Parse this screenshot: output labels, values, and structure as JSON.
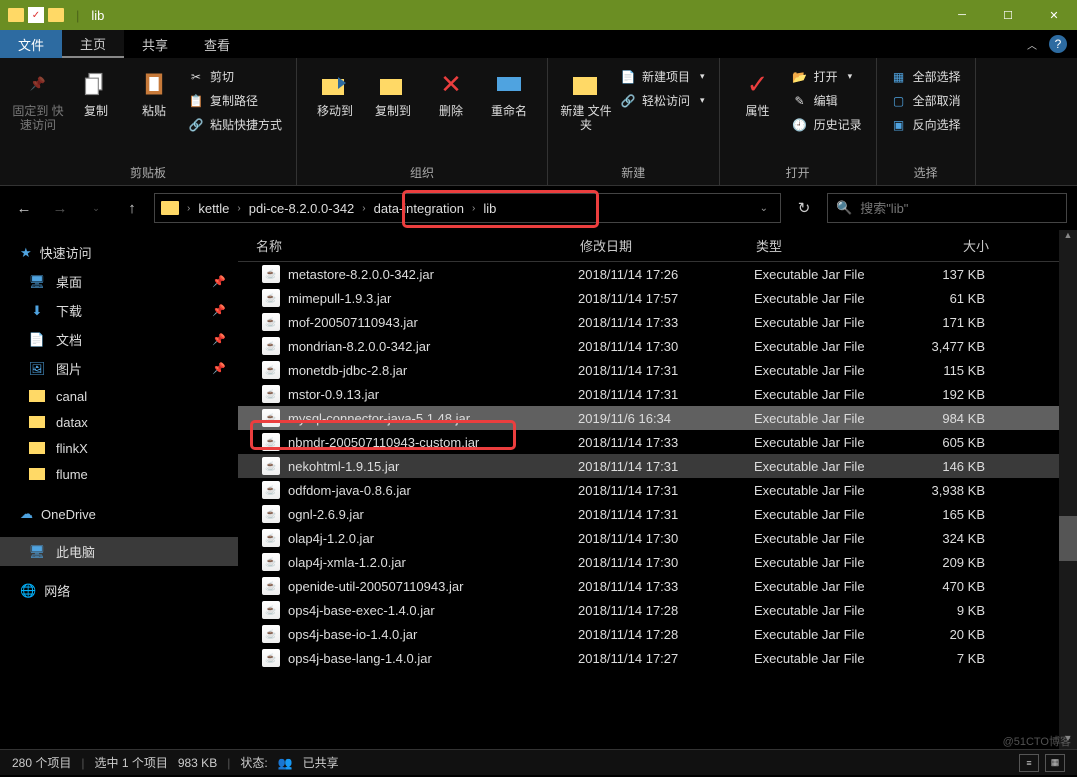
{
  "title": "lib",
  "tabs": {
    "file": "文件",
    "home": "主页",
    "share": "共享",
    "view": "查看"
  },
  "ribbon": {
    "clipboard": {
      "label": "剪贴板",
      "pin": "固定到\n快速访问",
      "copy": "复制",
      "paste": "粘贴",
      "cut": "剪切",
      "copypath": "复制路径",
      "pasteshort": "粘贴快捷方式"
    },
    "organize": {
      "label": "组织",
      "moveto": "移动到",
      "copyto": "复制到",
      "delete": "删除",
      "rename": "重命名"
    },
    "new": {
      "label": "新建",
      "newfolder": "新建\n文件夹",
      "newitem": "新建项目",
      "easyaccess": "轻松访问"
    },
    "open": {
      "label": "打开",
      "properties": "属性",
      "open": "打开",
      "edit": "编辑",
      "history": "历史记录"
    },
    "select": {
      "label": "选择",
      "selectall": "全部选择",
      "selectnone": "全部取消",
      "invert": "反向选择"
    }
  },
  "breadcrumbs": [
    "kettle",
    "pdi-ce-8.2.0.0-342",
    "data-integration",
    "lib"
  ],
  "search_placeholder": "搜索\"lib\"",
  "sidebar": {
    "quick": "快速访问",
    "items": [
      {
        "label": "桌面",
        "icon": "desktop",
        "pinned": true
      },
      {
        "label": "下载",
        "icon": "download",
        "pinned": true
      },
      {
        "label": "文档",
        "icon": "document",
        "pinned": true
      },
      {
        "label": "图片",
        "icon": "picture",
        "pinned": true
      },
      {
        "label": "canal",
        "icon": "folder",
        "pinned": false
      },
      {
        "label": "datax",
        "icon": "folder",
        "pinned": false
      },
      {
        "label": "flinkX",
        "icon": "folder",
        "pinned": false
      },
      {
        "label": "flume",
        "icon": "folder",
        "pinned": false
      }
    ],
    "onedrive": "OneDrive",
    "thispc": "此电脑",
    "network": "网络"
  },
  "columns": {
    "name": "名称",
    "date": "修改日期",
    "type": "类型",
    "size": "大小"
  },
  "files": [
    {
      "name": "metastore-8.2.0.0-342.jar",
      "date": "2018/11/14 17:26",
      "type": "Executable Jar File",
      "size": "137 KB",
      "sel": false
    },
    {
      "name": "mimepull-1.9.3.jar",
      "date": "2018/11/14 17:57",
      "type": "Executable Jar File",
      "size": "61 KB",
      "sel": false
    },
    {
      "name": "mof-200507110943.jar",
      "date": "2018/11/14 17:33",
      "type": "Executable Jar File",
      "size": "171 KB",
      "sel": false
    },
    {
      "name": "mondrian-8.2.0.0-342.jar",
      "date": "2018/11/14 17:30",
      "type": "Executable Jar File",
      "size": "3,477 KB",
      "sel": false
    },
    {
      "name": "monetdb-jdbc-2.8.jar",
      "date": "2018/11/14 17:31",
      "type": "Executable Jar File",
      "size": "115 KB",
      "sel": false
    },
    {
      "name": "mstor-0.9.13.jar",
      "date": "2018/11/14 17:31",
      "type": "Executable Jar File",
      "size": "192 KB",
      "sel": false
    },
    {
      "name": "mysql-connector-java-5.1.48.jar",
      "date": "2019/11/6 16:34",
      "type": "Executable Jar File",
      "size": "984 KB",
      "sel": true
    },
    {
      "name": "nbmdr-200507110943-custom.jar",
      "date": "2018/11/14 17:33",
      "type": "Executable Jar File",
      "size": "605 KB",
      "sel": false
    },
    {
      "name": "nekohtml-1.9.15.jar",
      "date": "2018/11/14 17:31",
      "type": "Executable Jar File",
      "size": "146 KB",
      "sel": "hover"
    },
    {
      "name": "odfdom-java-0.8.6.jar",
      "date": "2018/11/14 17:31",
      "type": "Executable Jar File",
      "size": "3,938 KB",
      "sel": false
    },
    {
      "name": "ognl-2.6.9.jar",
      "date": "2018/11/14 17:31",
      "type": "Executable Jar File",
      "size": "165 KB",
      "sel": false
    },
    {
      "name": "olap4j-1.2.0.jar",
      "date": "2018/11/14 17:30",
      "type": "Executable Jar File",
      "size": "324 KB",
      "sel": false
    },
    {
      "name": "olap4j-xmla-1.2.0.jar",
      "date": "2018/11/14 17:30",
      "type": "Executable Jar File",
      "size": "209 KB",
      "sel": false
    },
    {
      "name": "openide-util-200507110943.jar",
      "date": "2018/11/14 17:33",
      "type": "Executable Jar File",
      "size": "470 KB",
      "sel": false
    },
    {
      "name": "ops4j-base-exec-1.4.0.jar",
      "date": "2018/11/14 17:28",
      "type": "Executable Jar File",
      "size": "9 KB",
      "sel": false
    },
    {
      "name": "ops4j-base-io-1.4.0.jar",
      "date": "2018/11/14 17:28",
      "type": "Executable Jar File",
      "size": "20 KB",
      "sel": false
    },
    {
      "name": "ops4j-base-lang-1.4.0.jar",
      "date": "2018/11/14 17:27",
      "type": "Executable Jar File",
      "size": "7 KB",
      "sel": false
    }
  ],
  "status": {
    "items": "280 个项目",
    "selected": "选中 1 个项目",
    "selsize": "983 KB",
    "state": "状态:",
    "shared": "已共享"
  }
}
